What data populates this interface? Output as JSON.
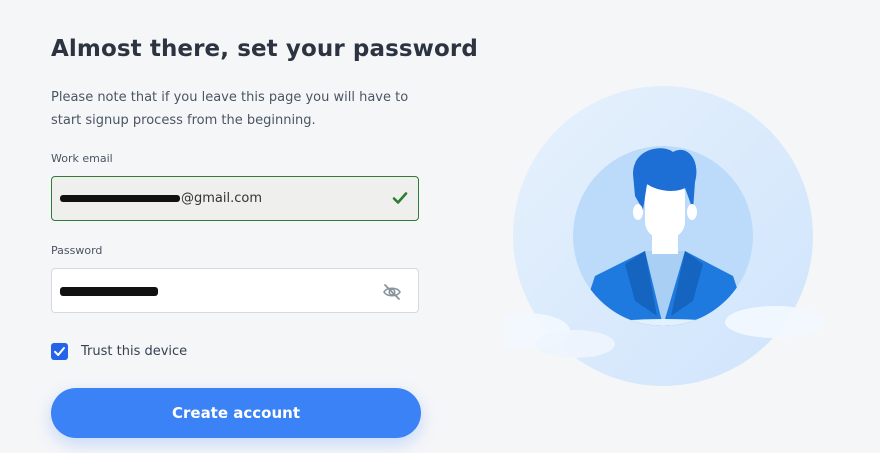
{
  "page": {
    "heading": "Almost there, set your password",
    "note": "Please note that if you leave this page you will have to start signup process from the beginning."
  },
  "form": {
    "email_label": "Work email",
    "email_value_visible": "@gmail.com",
    "password_label": "Password",
    "trust_label": "Trust this device",
    "trust_checked": true,
    "submit_label": "Create account"
  },
  "icons": {
    "email_status": "check-icon",
    "password_toggle": "eye-slash-icon",
    "illustration": "user-avatar-illustration"
  },
  "colors": {
    "accent": "#3b82f6",
    "valid": "#2e7d32",
    "checkbox": "#2563eb"
  }
}
